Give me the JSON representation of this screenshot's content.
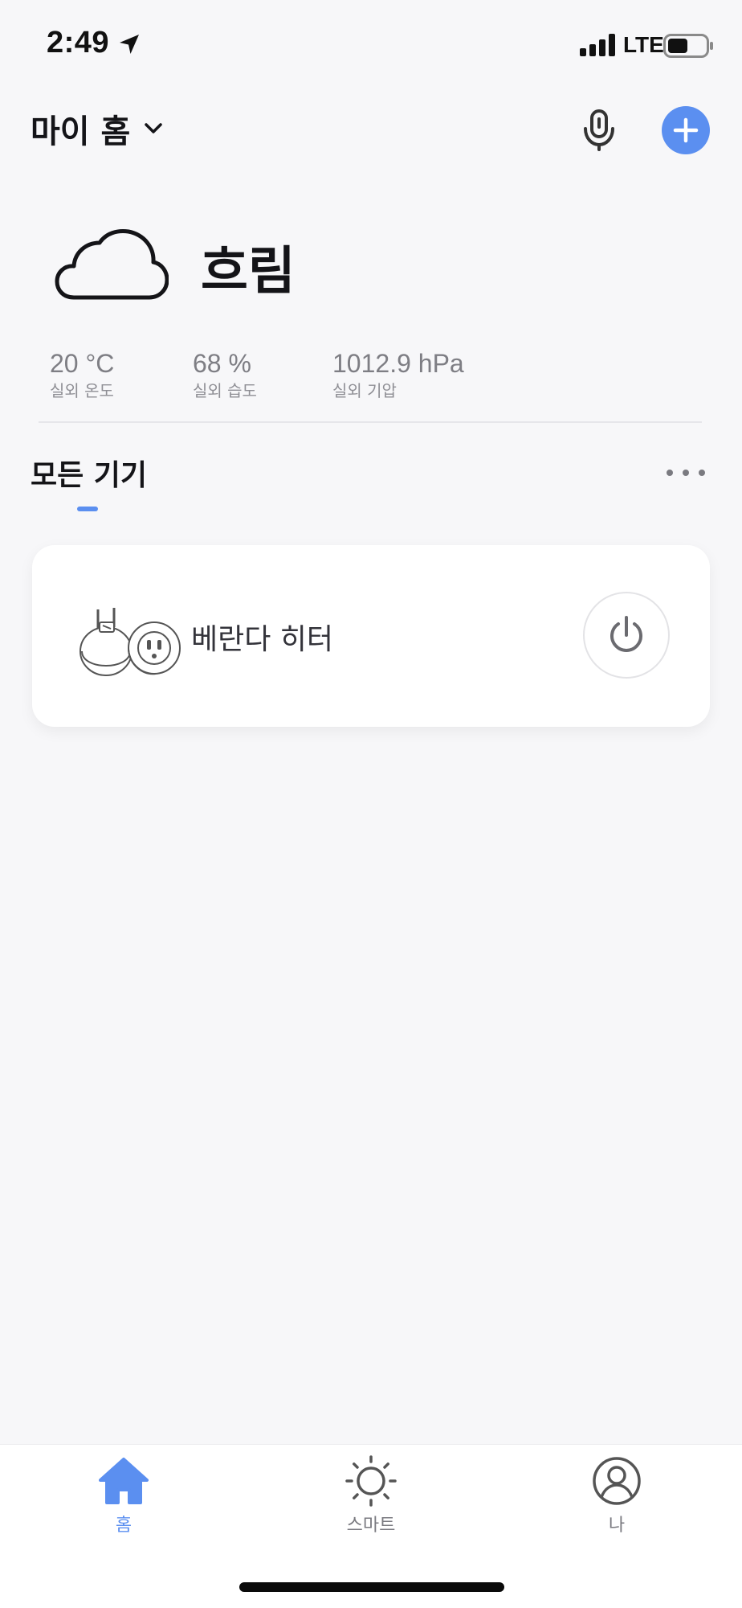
{
  "status_bar": {
    "time": "2:49",
    "network": "LTE",
    "icons": [
      "location-arrow-icon",
      "cellular-signal-icon",
      "battery-icon"
    ]
  },
  "header": {
    "home_name": "마이 홈",
    "icons": [
      "chevron-down-icon",
      "microphone-icon",
      "plus-icon"
    ],
    "accent_color": "#5b8ff0"
  },
  "weather": {
    "icon": "cloud-icon",
    "condition": "흐림",
    "stats": [
      {
        "value": "20 °C",
        "label": "실외 온도"
      },
      {
        "value": "68 %",
        "label": "실외 습도"
      },
      {
        "value": "1012.9 hPa",
        "label": "실외 기압"
      }
    ]
  },
  "devices_section": {
    "title": "모든 기기",
    "more_icon": "more-horizontal-icon",
    "devices": [
      {
        "name": "베란다 히터",
        "image": "smart-plug-image",
        "power_icon": "power-icon"
      }
    ]
  },
  "tab_bar": {
    "tabs": [
      {
        "label": "홈",
        "icon": "home-icon",
        "active": true
      },
      {
        "label": "스마트",
        "icon": "sun-icon",
        "active": false
      },
      {
        "label": "나",
        "icon": "user-profile-icon",
        "active": false
      }
    ],
    "active_color": "#5b8ff0",
    "inactive_color": "#7a7a80"
  }
}
